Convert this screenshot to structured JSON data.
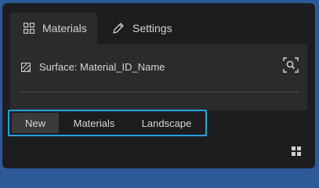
{
  "tabs": {
    "materials_label": "Materials",
    "settings_label": "Settings"
  },
  "surface": {
    "label": "Surface: Material_ID_Name"
  },
  "library_tabs": [
    {
      "label": "New"
    },
    {
      "label": "Materials"
    },
    {
      "label": "Landscape"
    }
  ],
  "icons": {
    "materials_tab": "grid-icon",
    "settings_tab": "pencil-icon",
    "surface": "hatched-swatch-icon",
    "search": "search-scan-icon",
    "view": "grid-view-icon"
  },
  "colors": {
    "background": "#2d5b9a",
    "panel": "#1d1d1f",
    "highlight": "#25a3e0"
  }
}
